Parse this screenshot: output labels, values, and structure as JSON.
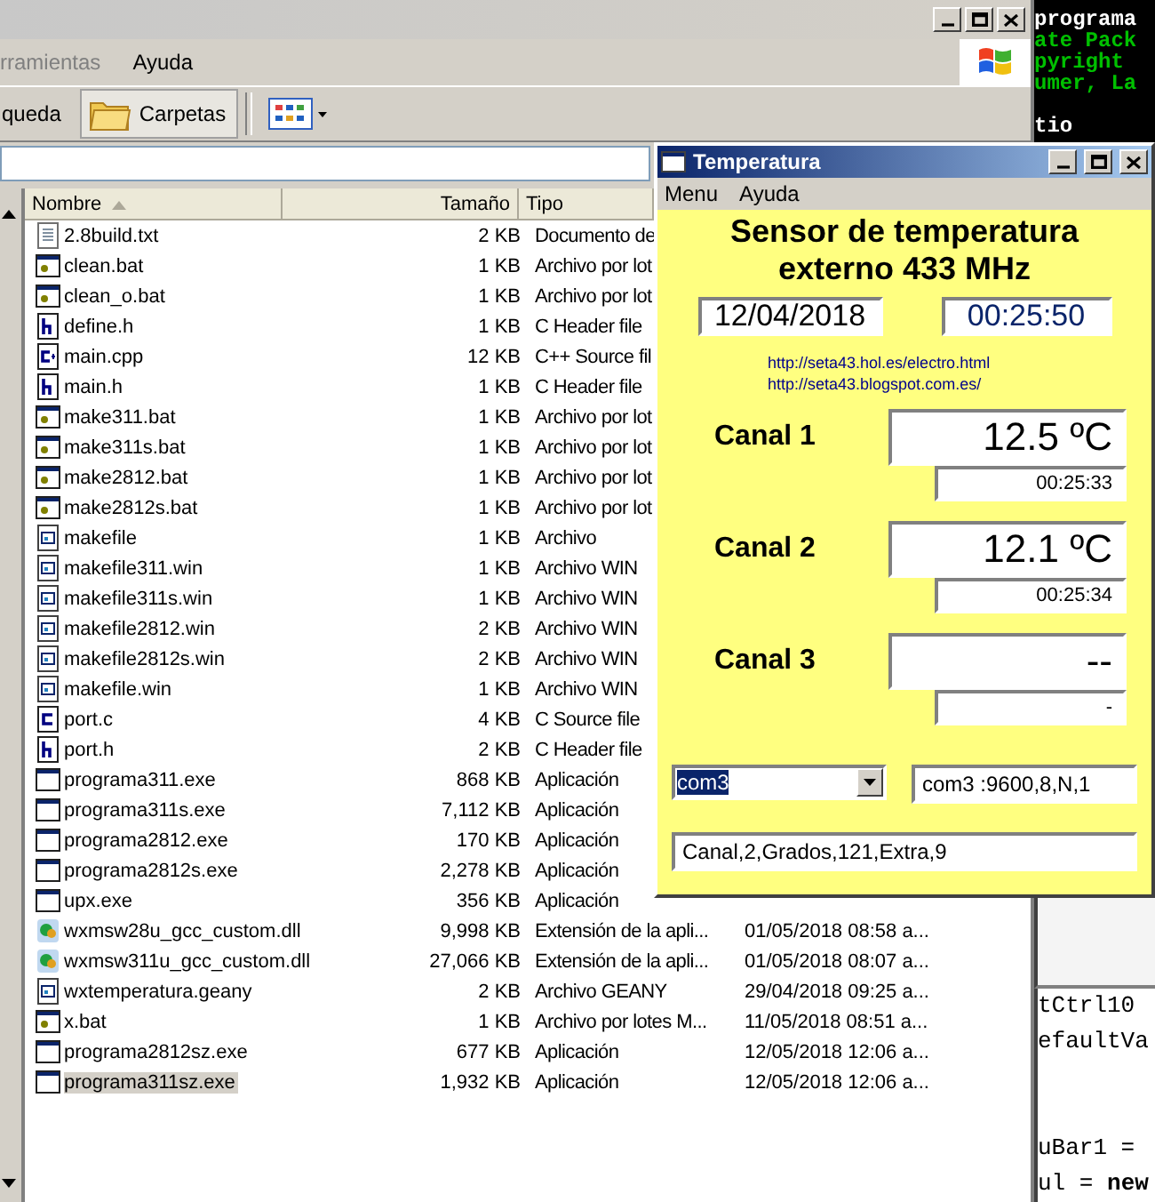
{
  "explorer": {
    "menu": [
      "rramientas",
      "Ayuda"
    ],
    "toolbar": [
      {
        "label": "queda",
        "selected": false
      },
      {
        "label": "Carpetas",
        "selected": true
      }
    ],
    "columns": [
      "Nombre",
      "Tamaño",
      "Tipo"
    ],
    "files": [
      {
        "name": "2.8build.txt",
        "size": "2 KB",
        "type": "Documento de",
        "kind": "txt",
        "selected": false
      },
      {
        "name": "clean.bat",
        "size": "1 KB",
        "type": "Archivo por lot",
        "kind": "bat",
        "selected": false
      },
      {
        "name": "clean_o.bat",
        "size": "1 KB",
        "type": "Archivo por lot",
        "kind": "bat",
        "selected": false
      },
      {
        "name": "define.h",
        "size": "1 KB",
        "type": "C Header file",
        "kind": "h",
        "selected": false
      },
      {
        "name": "main.cpp",
        "size": "12 KB",
        "type": "C++ Source fil",
        "kind": "cpp",
        "selected": false
      },
      {
        "name": "main.h",
        "size": "1 KB",
        "type": "C Header file",
        "kind": "h",
        "selected": false
      },
      {
        "name": "make311.bat",
        "size": "1 KB",
        "type": "Archivo por lot",
        "kind": "bat",
        "selected": false
      },
      {
        "name": "make311s.bat",
        "size": "1 KB",
        "type": "Archivo por lot",
        "kind": "bat",
        "selected": false
      },
      {
        "name": "make2812.bat",
        "size": "1 KB",
        "type": "Archivo por lot",
        "kind": "bat",
        "selected": false
      },
      {
        "name": "make2812s.bat",
        "size": "1 KB",
        "type": "Archivo por lot",
        "kind": "bat",
        "selected": false
      },
      {
        "name": "makefile",
        "size": "1 KB",
        "type": "Archivo",
        "kind": "win",
        "selected": false
      },
      {
        "name": "makefile311.win",
        "size": "1 KB",
        "type": "Archivo WIN",
        "kind": "win",
        "selected": false
      },
      {
        "name": "makefile311s.win",
        "size": "1 KB",
        "type": "Archivo WIN",
        "kind": "win",
        "selected": false
      },
      {
        "name": "makefile2812.win",
        "size": "2 KB",
        "type": "Archivo WIN",
        "kind": "win",
        "selected": false
      },
      {
        "name": "makefile2812s.win",
        "size": "2 KB",
        "type": "Archivo WIN",
        "kind": "win",
        "selected": false
      },
      {
        "name": "makefile.win",
        "size": "1 KB",
        "type": "Archivo WIN",
        "kind": "win",
        "selected": false
      },
      {
        "name": "port.c",
        "size": "4 KB",
        "type": "C Source file",
        "kind": "c",
        "selected": false
      },
      {
        "name": "port.h",
        "size": "2 KB",
        "type": "C Header file",
        "kind": "h",
        "selected": false
      },
      {
        "name": "programa311.exe",
        "size": "868 KB",
        "type": "Aplicación",
        "kind": "exe",
        "selected": false
      },
      {
        "name": "programa311s.exe",
        "size": "7,112 KB",
        "type": "Aplicación",
        "kind": "exe",
        "selected": false
      },
      {
        "name": "programa2812.exe",
        "size": "170 KB",
        "type": "Aplicación",
        "kind": "exe",
        "selected": false
      },
      {
        "name": "programa2812s.exe",
        "size": "2,278 KB",
        "type": "Aplicación",
        "kind": "exe",
        "selected": false
      },
      {
        "name": "upx.exe",
        "size": "356 KB",
        "type": "Aplicación",
        "kind": "exe",
        "selected": false
      },
      {
        "name": "wxmsw28u_gcc_custom.dll",
        "size": "9,998 KB",
        "type": "Extensión de la apli...",
        "date": "01/05/2018 08:58 a...",
        "kind": "dll",
        "selected": false
      },
      {
        "name": "wxmsw311u_gcc_custom.dll",
        "size": "27,066 KB",
        "type": "Extensión de la apli...",
        "date": "01/05/2018 08:07 a...",
        "kind": "dll",
        "selected": false
      },
      {
        "name": "wxtemperatura.geany",
        "size": "2 KB",
        "type": "Archivo GEANY",
        "date": "29/04/2018 09:25 a...",
        "kind": "win",
        "selected": false
      },
      {
        "name": "x.bat",
        "size": "1 KB",
        "type": "Archivo por lotes M...",
        "date": "11/05/2018 08:51 a...",
        "kind": "bat",
        "selected": false
      },
      {
        "name": "programa2812sz.exe",
        "size": "677 KB",
        "type": "Aplicación",
        "date": "12/05/2018 12:06 a...",
        "kind": "exe",
        "selected": false
      },
      {
        "name": "programa311sz.exe",
        "size": "1,932 KB",
        "type": "Aplicación",
        "date": "12/05/2018 12:06 a...",
        "kind": "exe",
        "selected": true
      }
    ]
  },
  "console": {
    "lines": [
      {
        "text": "programa",
        "color": "#ffffff"
      },
      {
        "text": "ate Pack",
        "color": "#00c000"
      },
      {
        "text": "pyright",
        "color": "#00c000"
      },
      {
        "text": "umer, La",
        "color": "#00c000"
      },
      {
        "text": "tio",
        "color": "#ffffff"
      }
    ]
  },
  "editor": {
    "lines": [
      "tCtrl10",
      "efaultVa",
      "uBar1 =",
      "ul = **new**"
    ]
  },
  "temperature_window": {
    "title": "Temperatura",
    "menu": [
      "Menu",
      "Ayuda"
    ],
    "heading": "Sensor de temperatura externo 433 MHz",
    "date": "12/04/2018",
    "time": "00:25:50",
    "links": [
      "http://seta43.hol.es/electro.html",
      "http://seta43.blogspot.com.es/"
    ],
    "channels": [
      {
        "label": "Canal 1",
        "value": "12.5 ºC",
        "time": "00:25:33"
      },
      {
        "label": "Canal 2",
        "value": "12.1 ºC",
        "time": "00:25:34"
      },
      {
        "label": "Canal 3",
        "value": "--",
        "time": "-"
      }
    ],
    "port": "com3",
    "port_settings": "com3 :9600,8,N,1",
    "last_message": "Canal,2,Grados,121,Extra,9"
  }
}
